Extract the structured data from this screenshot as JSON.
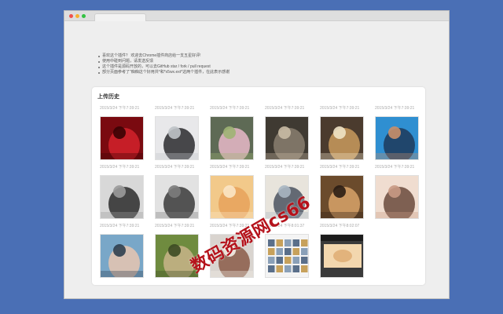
{
  "notes": [
    "喜欢这个插件？ 欢迎去Chrome插件商店给一支五星好评!",
    "使用中碰到问题，请发送反馈",
    "这个插件是源码开放的，可以去GitHub star / fork / pull request",
    "部分页面参考了\"痴痴这个好用共*和*x5wx.ext*这两个插件，在此表示感谢"
  ],
  "panel": {
    "title": "上传历史"
  },
  "history": {
    "rows": [
      {
        "items": [
          {
            "timestamp": "2015/3/24 下午7:39:21",
            "subject": "red-guitar-concert-photo"
          },
          {
            "timestamp": "2015/3/24 下午7:39:21",
            "subject": "phone-and-gadgets-photo"
          },
          {
            "timestamp": "2015/3/24 下午7:39:21",
            "subject": "flowers-on-desk-photo"
          },
          {
            "timestamp": "2015/3/24 下午7:39:21",
            "subject": "cat-portrait-photo"
          },
          {
            "timestamp": "2015/3/24 下午7:39:21",
            "subject": "plush-bear-characters-photo"
          },
          {
            "timestamp": "2015/3/24 下午7:39:21",
            "subject": "man-on-blue-background-photo"
          }
        ]
      },
      {
        "items": [
          {
            "timestamp": "2015/3/24 下午7:39:21",
            "subject": "bw-wedding-photo"
          },
          {
            "timestamp": "2015/3/24 下午7:39:21",
            "subject": "bw-couple-photo"
          },
          {
            "timestamp": "2015/3/24 下午7:39:21",
            "subject": "hands-close-up-photo"
          },
          {
            "timestamp": "2015/3/24 下午7:39:21",
            "subject": "couple-by-window-photo"
          },
          {
            "timestamp": "2015/3/24 下午7:39:21",
            "subject": "couple-embracing-photo"
          },
          {
            "timestamp": "2015/3/24 下午7:39:21",
            "subject": "two-women-portrait-photo"
          }
        ]
      },
      {
        "items": [
          {
            "timestamp": "2015/3/24 下午7:39:21",
            "subject": "couple-selfie-photo"
          },
          {
            "timestamp": "2015/3/24 下午7:39:21",
            "subject": "couple-with-goat-photo"
          },
          {
            "timestamp": "2015/3/24 下午7:39:21",
            "subject": "couple-outdoors-photo"
          },
          {
            "timestamp": "2015/3/24 下午8:01:37",
            "subject": "screenshot-grid-photo"
          },
          {
            "timestamp": "2015/3/24 下午8:02:07",
            "subject": "dark-app-screenshot-photo"
          }
        ]
      }
    ]
  },
  "watermark": "数码资源网cs66"
}
